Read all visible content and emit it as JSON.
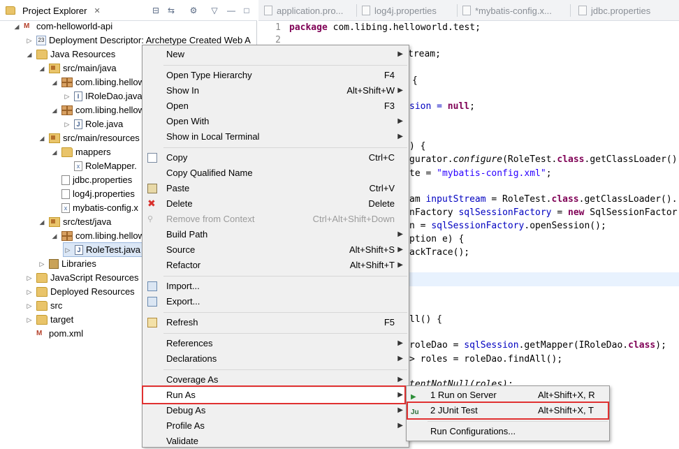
{
  "explorer": {
    "tab_label": "Project Explorer",
    "tree": [
      {
        "label": "com-helloworld-api",
        "icon": "maven-project-icon"
      },
      {
        "label": "Deployment Descriptor: Archetype Created Web A",
        "icon": "descriptor-icon"
      },
      {
        "label": "Java Resources",
        "icon": "folder-icon"
      },
      {
        "label": "src/main/java",
        "icon": "source-folder-icon"
      },
      {
        "label": "com.libing.hellow",
        "icon": "package-icon"
      },
      {
        "label": "IRoleDao.java",
        "icon": "java-file-icon"
      },
      {
        "label": "com.libing.hellow",
        "icon": "package-icon"
      },
      {
        "label": "Role.java",
        "icon": "java-file-icon"
      },
      {
        "label": "src/main/resources",
        "icon": "source-folder-icon"
      },
      {
        "label": "mappers",
        "icon": "folder-icon"
      },
      {
        "label": "RoleMapper.",
        "icon": "xml-file-icon"
      },
      {
        "label": "jdbc.properties",
        "icon": "file-icon"
      },
      {
        "label": "log4j.properties",
        "icon": "file-icon"
      },
      {
        "label": "mybatis-config.x",
        "icon": "xml-file-icon"
      },
      {
        "label": "src/test/java",
        "icon": "source-folder-icon"
      },
      {
        "label": "com.libing.hellow",
        "icon": "package-icon"
      },
      {
        "label": "RoleTest.java",
        "icon": "java-file-icon"
      },
      {
        "label": "Libraries",
        "icon": "library-icon"
      },
      {
        "label": "JavaScript Resources",
        "icon": "folder-icon"
      },
      {
        "label": "Deployed Resources",
        "icon": "folder-icon"
      },
      {
        "label": "src",
        "icon": "folder-icon"
      },
      {
        "label": "target",
        "icon": "folder-icon"
      },
      {
        "label": "pom.xml",
        "icon": "maven-file-icon"
      }
    ]
  },
  "editor": {
    "tabs": [
      "application.pro...",
      "log4j.properties",
      "*mybatis-config.x...",
      "jdbc.properties"
    ],
    "line_numbers": [
      "1",
      "2"
    ],
    "code": {
      "l1_kw": "package",
      "l1_rest": " com.libing.helloworld.test;",
      "l2": "tream;",
      "l3": "{",
      "l4_a": "sion = ",
      "l4_kw": "null",
      "l4_b": ";",
      "l5": ") {",
      "l6_a": "gurator.",
      "l6_it": "configure",
      "l6_b": "(RoleTest.",
      "l6_kw": "class",
      "l6_c": ".getClassLoader()",
      "l7_a": "te = ",
      "l7_str": "\"mybatis-config.xml\"",
      "l7_b": ";",
      "l8_a": "am ",
      "l8_var": "inputStream",
      "l8_b": " = RoleTest.",
      "l8_kw": "class",
      "l8_c": ".getClassLoader().",
      "l9_a": "nFactory ",
      "l9_var": "sqlSessionFactory",
      "l9_b": " = ",
      "l9_kw": "new",
      "l9_c": " SqlSessionFactor",
      "l10_a": "n = ",
      "l10_var": "sqlSessionFactory",
      "l10_b": ".openSession();",
      "l11": "ption e) {",
      "l12": "ackTrace();",
      "l13": "ll() {",
      "l14_a": "roleDao = ",
      "l14_var": "sqlSession",
      "l14_b": ".getMapper(IRoleDao.",
      "l14_kw": "class",
      "l14_c": ");",
      "l15": "> roles = roleDao.findAll();",
      "l16": "tentNotNull(roles);"
    }
  },
  "context_menu": {
    "items": [
      {
        "label": "New",
        "shortcut": "",
        "submenu": true
      },
      {
        "label": "Open Type Hierarchy",
        "shortcut": "F4"
      },
      {
        "label": "Show In",
        "shortcut": "Alt+Shift+W",
        "submenu": true
      },
      {
        "label": "Open",
        "shortcut": "F3"
      },
      {
        "label": "Open With",
        "shortcut": "",
        "submenu": true
      },
      {
        "label": "Show in Local Terminal",
        "shortcut": "",
        "submenu": true
      },
      {
        "label": "Copy",
        "shortcut": "Ctrl+C"
      },
      {
        "label": "Copy Qualified Name",
        "shortcut": ""
      },
      {
        "label": "Paste",
        "shortcut": "Ctrl+V"
      },
      {
        "label": "Delete",
        "shortcut": "Delete"
      },
      {
        "label": "Remove from Context",
        "shortcut": "Ctrl+Alt+Shift+Down"
      },
      {
        "label": "Build Path",
        "shortcut": "",
        "submenu": true
      },
      {
        "label": "Source",
        "shortcut": "Alt+Shift+S",
        "submenu": true
      },
      {
        "label": "Refactor",
        "shortcut": "Alt+Shift+T",
        "submenu": true
      },
      {
        "label": "Import...",
        "shortcut": ""
      },
      {
        "label": "Export...",
        "shortcut": ""
      },
      {
        "label": "Refresh",
        "shortcut": "F5"
      },
      {
        "label": "References",
        "shortcut": "",
        "submenu": true
      },
      {
        "label": "Declarations",
        "shortcut": "",
        "submenu": true
      },
      {
        "label": "Coverage As",
        "shortcut": "",
        "submenu": true
      },
      {
        "label": "Run As",
        "shortcut": "",
        "submenu": true
      },
      {
        "label": "Debug As",
        "shortcut": "",
        "submenu": true
      },
      {
        "label": "Profile As",
        "shortcut": "",
        "submenu": true
      },
      {
        "label": "Validate",
        "shortcut": ""
      }
    ]
  },
  "run_as_submenu": {
    "items": [
      {
        "label": "1 Run on Server",
        "shortcut": "Alt+Shift+X, R"
      },
      {
        "label": "2 JUnit Test",
        "shortcut": "Alt+Shift+X, T"
      },
      {
        "label": "Run Configurations...",
        "shortcut": ""
      }
    ]
  },
  "colors": {
    "highlight_box": "#e03131",
    "menu_bg": "#f0f0f0",
    "keyword": "#7f0055",
    "string": "#2a00ff"
  }
}
